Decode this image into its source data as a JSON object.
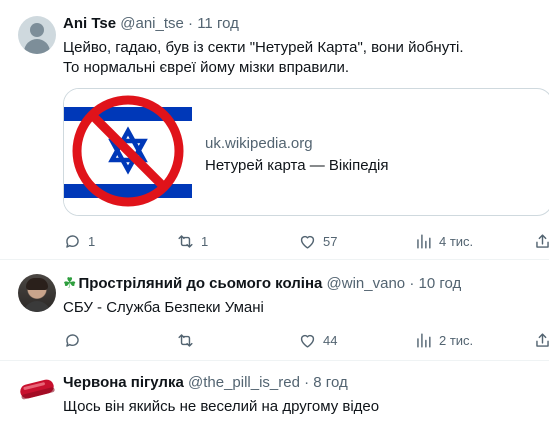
{
  "tweets": [
    {
      "author": "Ani Tse",
      "handle": "@ani_tse",
      "separator": "·",
      "time": "11 год",
      "avatar": "default-avatar",
      "text_lines": [
        "Цейво, гадаю, був із секти \"Нетурей Карта\", вони йобнуті.",
        "То нормальні євреї йому мізки вправили."
      ],
      "card": {
        "domain": "uk.wikipedia.org",
        "title": "Нетурей карта — Вікіпедія",
        "image": "crossed-out-israel-flag"
      },
      "stats": {
        "replies": "1",
        "retweets": "1",
        "likes": "57",
        "views": "4 тис."
      }
    },
    {
      "author_prefix": "☘",
      "author": "Простріляний до сьомого коліна",
      "handle": "@win_vano",
      "separator": "·",
      "time": "10 год",
      "avatar": "profile-photo",
      "text_lines": [
        "СБУ - Служба Безпеки Умані"
      ],
      "stats": {
        "replies": "",
        "retweets": "",
        "likes": "44",
        "views": "2 тис."
      }
    },
    {
      "author": "Червона пігулка",
      "handle": "@the_pill_is_red",
      "separator": "·",
      "time": "8 год",
      "avatar": "red-pill",
      "text_lines": [
        "Щось він якийсь не веселий на другому відео"
      ]
    }
  ],
  "icons": {
    "reply": "reply-icon",
    "retweet": "retweet-icon",
    "like": "heart-icon",
    "views": "views-bar-chart-icon",
    "share": "share-icon"
  },
  "colors": {
    "text": "#0f1419",
    "muted": "#536471",
    "border": "#cfd9de",
    "flag_blue": "#0038b8",
    "prohibit_red": "#e0131a",
    "pill_red": "#c8102e",
    "clover_green": "#2e9e3e"
  }
}
